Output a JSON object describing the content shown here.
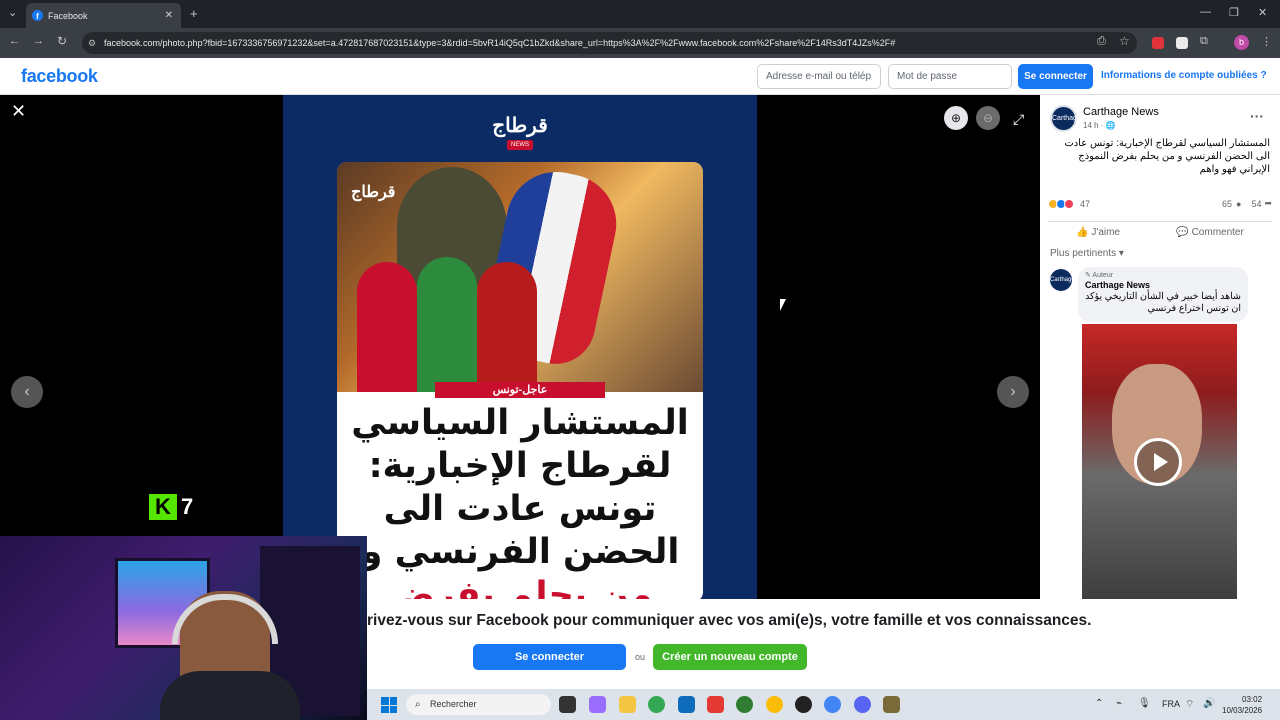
{
  "browser": {
    "tab_title": "Facebook",
    "tab_favicon": "f",
    "new_tab": "+",
    "url": "facebook.com/photo.php?fbid=1673336756971232&set=a.472817687023151&type=3&rdid=5bvR14iQ5qC1bZkd&share_url=https%3A%2F%2Fwww.facebook.com%2Fshare%2F14Rs3dT4JZs%2F#",
    "profile_letter": "b"
  },
  "fb_header": {
    "logo": "facebook",
    "email_placeholder": "Adresse e-mail ou télép",
    "password_placeholder": "Mot de passe",
    "login_label": "Se connecter",
    "forgot_label": "Informations de compte oubliées ?"
  },
  "photo": {
    "logo": "قرطاج",
    "news_badge": "NEWS",
    "watermark": "قرطاج",
    "urgent_label": "عاجل-تونس",
    "headline_black": "المستشار السياسي لقرطاج الإخبارية: تونس عادت الى الحضن الفرنسي و",
    "headline_red": "من يحلم بفرض النموذج الإيراني فهو واهم",
    "overlay_count": "7",
    "overlay_letter": "K"
  },
  "post": {
    "page_name": "Carthage News",
    "avatar_text": "Carthage",
    "time": "14 h · ",
    "more": "···",
    "text": "المستشار السياسي لقرطاج الإخبارية: تونس عادت الى الحضن الفرنسي و من يحلم بفرض النموذج الإيراني فهو واهم",
    "reaction_count": "47",
    "comment_count": "65",
    "share_count": "54",
    "like_label": "J'aime",
    "comment_label": "Commenter",
    "sort_label": "Plus pertinents ▾",
    "comment": {
      "badge": "✎ Auteur",
      "author": "Carthage News",
      "text": "شاهد أيضا خبير في الشأن التاريخي يؤكد ان تونس اختراع فرنسي"
    }
  },
  "banner": {
    "text": "rivez-vous sur Facebook pour communiquer avec vos ami(e)s, votre famille et vos connaissances.",
    "login_label": "Se connecter",
    "or_label": "ou",
    "create_label": "Créer un nouveau compte"
  },
  "taskbar": {
    "search_placeholder": "Rechercher",
    "language": "FRA",
    "time": "03:02",
    "date": "10/03/2026"
  },
  "icons": {
    "close": "✕",
    "zoom_in": "⊕",
    "zoom_out": "⊖",
    "fullscreen": "⤢",
    "prev": "‹",
    "next": "›",
    "back": "←",
    "forward": "→",
    "reload": "↻",
    "star": "☆",
    "menu": "⋮",
    "like": "👍",
    "comment": "💬",
    "search": "⌕"
  },
  "colors": {
    "brand": "#1877f2",
    "create_green": "#42b72a",
    "photo_bg": "#0c2a63",
    "urgent_red": "#c8102e"
  }
}
